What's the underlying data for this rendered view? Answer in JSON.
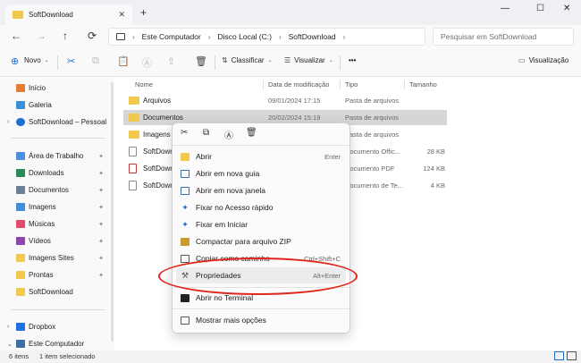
{
  "window": {
    "tab_title": "SoftDownload",
    "tab_close": "✕",
    "new_tab": "+",
    "minimize": "—",
    "maximize": "☐",
    "close": "✕"
  },
  "address": {
    "back": "←",
    "forward": "→",
    "up": "↑",
    "refresh": "⟳",
    "crumbs": [
      "Este Computador",
      "Disco Local (C:)",
      "SoftDownload"
    ],
    "crumb_separator": "›",
    "search_placeholder": "Pesquisar em SoftDownload"
  },
  "toolbar": {
    "new_label": "Novo",
    "sort_label": "Classificar",
    "view_label": "Visualizar",
    "more": "•••",
    "preview_label": "Visualização"
  },
  "sidebar": {
    "items": [
      {
        "label": "Início",
        "color": "#e37d36",
        "chevron": ""
      },
      {
        "label": "Galeria",
        "color": "#3a8fd8",
        "chevron": ""
      },
      {
        "label": "SoftDownload – Pessoal",
        "color": "#1f6fd1",
        "chevron": "›"
      },
      {
        "label": "Área de Trabalho",
        "color": "#4a8fe0",
        "chevron": "",
        "pinned": true
      },
      {
        "label": "Downloads",
        "color": "#2b8a5a",
        "chevron": "",
        "pinned": true
      },
      {
        "label": "Documentos",
        "color": "#6b7f93",
        "chevron": "",
        "pinned": true
      },
      {
        "label": "Imagens",
        "color": "#3f8fd9",
        "chevron": "",
        "pinned": true
      },
      {
        "label": "Músicas",
        "color": "#e24c6a",
        "chevron": "",
        "pinned": true
      },
      {
        "label": "Vídeos",
        "color": "#8e44ad",
        "chevron": "",
        "pinned": true
      },
      {
        "label": "Imagens Sites",
        "color": "#f2c94c",
        "chevron": "",
        "pinned": true
      },
      {
        "label": "Prontas",
        "color": "#f2c94c",
        "chevron": "",
        "pinned": true
      },
      {
        "label": "SoftDownload",
        "color": "#f2c94c",
        "chevron": ""
      },
      {
        "label": "Dropbox",
        "color": "#1f6fe5",
        "chevron": "›"
      },
      {
        "label": "Este Computador",
        "color": "#3a6ea5",
        "chevron": "⌄"
      }
    ],
    "pin_glyph": "📌"
  },
  "columns": {
    "name": "Nome",
    "modified": "Data de modificação",
    "type": "Tipo",
    "size": "Tamanho"
  },
  "files": [
    {
      "name": "Arquivos",
      "date": "09/01/2024 17:15",
      "type": "Pasta de arquivos",
      "size": "",
      "kind": "folder"
    },
    {
      "name": "Documentos",
      "date": "20/02/2024 15:19",
      "type": "Pasta de arquivos",
      "size": "",
      "kind": "folder",
      "selected": true
    },
    {
      "name": "Imagens",
      "date": "",
      "type": "Pasta de arquivos",
      "size": "",
      "kind": "folder"
    },
    {
      "name": "SoftDownlo",
      "date": "",
      "type": "Documento Offic...",
      "size": "28 KB",
      "kind": "doc"
    },
    {
      "name": "SoftDownlo",
      "date": "",
      "type": "Documento PDF",
      "size": "124 KB",
      "kind": "pdf"
    },
    {
      "name": "SoftDownlo",
      "date": "",
      "type": "Documento de Te...",
      "size": "4 KB",
      "kind": "doc"
    }
  ],
  "context_menu": {
    "top_icons": [
      "cut-icon",
      "copy-icon",
      "rename-icon",
      "delete-icon"
    ],
    "top_glyphs": [
      "✂",
      "⧉",
      "Ⓐ",
      "🗑"
    ],
    "items": [
      {
        "label": "Abrir",
        "shortcut": "Enter",
        "icon_color": "#f2c94c"
      },
      {
        "label": "Abrir em nova guia",
        "shortcut": "",
        "icon_color": "#3a6ea5"
      },
      {
        "label": "Abrir em nova janela",
        "shortcut": "",
        "icon_color": "#3a6ea5"
      },
      {
        "label": "Fixar no Acesso rápido",
        "shortcut": "",
        "icon_color": "#1f6fd1"
      },
      {
        "label": "Fixar em Iniciar",
        "shortcut": "",
        "icon_color": "#1f6fd1"
      },
      {
        "label": "Compactar para arquivo ZIP",
        "shortcut": "",
        "icon_color": "#c89b2a"
      },
      {
        "label": "Copiar como caminho",
        "shortcut": "Ctrl+Shift+C",
        "icon_color": "#555555"
      },
      {
        "label": "Propriedades",
        "shortcut": "Alt+Enter",
        "icon_color": "#555555"
      },
      {
        "label": "Abrir no Terminal",
        "shortcut": "",
        "icon_color": "#222222"
      },
      {
        "label": "Mostrar mais opções",
        "shortcut": "",
        "icon_color": "#555555"
      }
    ]
  },
  "status": {
    "count": "6 itens",
    "selected": "1 item selecionado"
  },
  "colors": {
    "accent": "#1a6fd1",
    "highlight_oval": "#e0251b",
    "selection": "#d6d6d6",
    "folder": "#f2c94c"
  }
}
